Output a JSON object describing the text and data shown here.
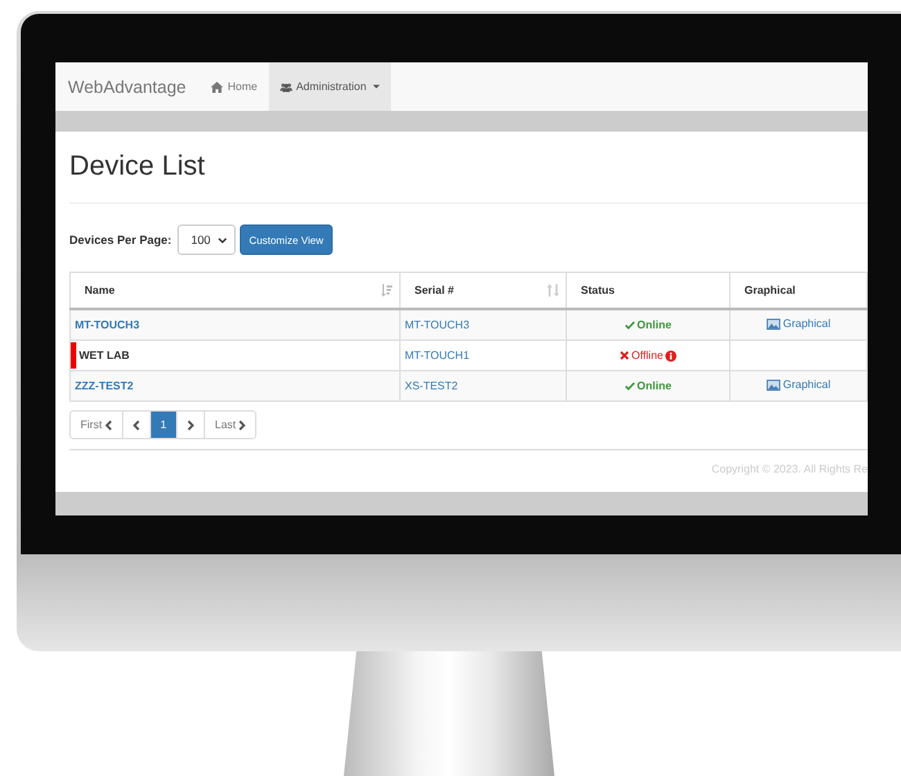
{
  "navbar": {
    "brand": "WebAdvantage",
    "items": [
      {
        "label": "Home",
        "kind": "home",
        "selected": false,
        "dropdown": false
      },
      {
        "label": "Administration",
        "kind": "users",
        "selected": true,
        "dropdown": true
      }
    ]
  },
  "page_title": "Device List",
  "per_page": {
    "label": "Devices Per Page:",
    "value": "100"
  },
  "customize_button": "Customize View",
  "table": {
    "columns": [
      {
        "label": "Name",
        "sortable": true
      },
      {
        "label": "Serial #",
        "sortable": true
      },
      {
        "label": "Status",
        "sortable": false
      },
      {
        "label": "Graphical",
        "sortable": false
      }
    ],
    "rows": [
      {
        "name": "MT-TOUCH3",
        "flagged": false,
        "serial": "MT-TOUCH3",
        "status": {
          "kind": "online",
          "label": "Online"
        },
        "graphical": "Graphical"
      },
      {
        "name": "WET LAB",
        "flagged": true,
        "serial": "MT-TOUCH1",
        "status": {
          "kind": "offline",
          "label": "Offline"
        }
      },
      {
        "name": "ZZZ-TEST2",
        "flagged": false,
        "serial": "XS-TEST2",
        "status": {
          "kind": "online",
          "label": "Online"
        },
        "graphical": "Graphical"
      }
    ]
  },
  "pagination": [
    {
      "kind": "first",
      "label": "First",
      "selected": false
    },
    {
      "kind": "prev",
      "selected": false
    },
    {
      "kind": "page",
      "label": "1",
      "selected": true
    },
    {
      "kind": "next",
      "selected": false
    },
    {
      "kind": "last",
      "label": "Last",
      "selected": false
    }
  ],
  "footer": "Copyright © 2023. All Rights Re"
}
